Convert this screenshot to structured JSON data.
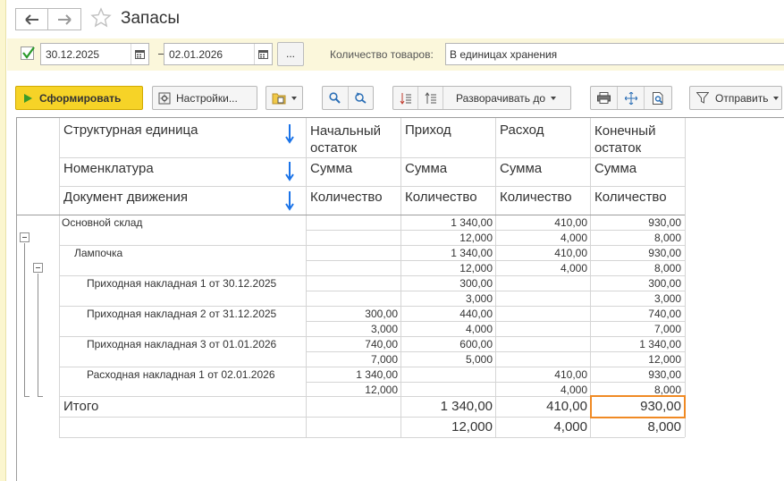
{
  "window": {
    "title": "Запасы"
  },
  "filters": {
    "period_enabled": true,
    "date_from": "30.12.2025",
    "date_to": "02.01.2026",
    "dash": "–",
    "dots": "...",
    "quantity_label": "Количество товаров:",
    "quantity_value": "В единицах хранения"
  },
  "toolbar": {
    "generate": "Сформировать",
    "settings": "Настройки...",
    "expand_to": "Разворачивать до",
    "send": "Отправить"
  },
  "report": {
    "header": {
      "rows": [
        {
          "label": "Структурная единица",
          "cols": [
            "Начальный остаток",
            "Приход",
            "Расход",
            "Конечный остаток"
          ]
        },
        {
          "label": "Номенклатура",
          "cols": [
            "Сумма",
            "Сумма",
            "Сумма",
            "Сумма"
          ]
        },
        {
          "label": "Документ движения",
          "cols": [
            "Количество",
            "Количество",
            "Количество",
            "Количество"
          ]
        }
      ]
    },
    "rows": [
      {
        "label": "Основной склад",
        "sum": [
          "",
          "1 340,00",
          "410,00",
          "930,00"
        ],
        "qty": [
          "",
          "12,000",
          "4,000",
          "8,000"
        ]
      },
      {
        "label": "Лампочка",
        "sum": [
          "",
          "1 340,00",
          "410,00",
          "930,00"
        ],
        "qty": [
          "",
          "12,000",
          "4,000",
          "8,000"
        ]
      },
      {
        "label": "Приходная накладная 1 от 30.12.2025",
        "sum": [
          "",
          "300,00",
          "",
          "300,00"
        ],
        "qty": [
          "",
          "3,000",
          "",
          "3,000"
        ]
      },
      {
        "label": "Приходная накладная 2 от 31.12.2025",
        "sum": [
          "300,00",
          "440,00",
          "",
          "740,00"
        ],
        "qty": [
          "3,000",
          "4,000",
          "",
          "7,000"
        ]
      },
      {
        "label": "Приходная накладная 3 от 01.01.2026",
        "sum": [
          "740,00",
          "600,00",
          "",
          "1 340,00"
        ],
        "qty": [
          "7,000",
          "5,000",
          "",
          "12,000"
        ]
      },
      {
        "label": "Расходная накладная 1 от 02.01.2026",
        "sum": [
          "1 340,00",
          "",
          "410,00",
          "930,00"
        ],
        "qty": [
          "12,000",
          "",
          "4,000",
          "8,000"
        ]
      }
    ],
    "total": {
      "label": "Итого",
      "sum": [
        "",
        "1 340,00",
        "410,00",
        "930,00"
      ],
      "qty": [
        "",
        "12,000",
        "4,000",
        "8,000"
      ]
    }
  }
}
